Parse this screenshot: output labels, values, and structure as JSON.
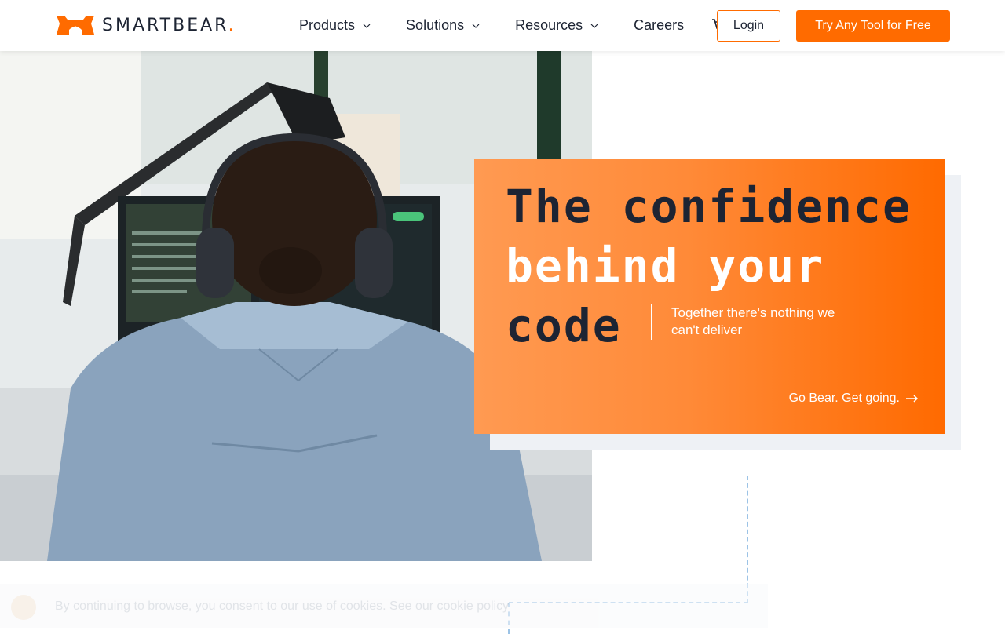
{
  "header": {
    "brand": "SMARTBEAR",
    "brand_suffix": ".",
    "nav": [
      {
        "label": "Products",
        "has_dropdown": true
      },
      {
        "label": "Solutions",
        "has_dropdown": true
      },
      {
        "label": "Resources",
        "has_dropdown": true
      },
      {
        "label": "Careers",
        "has_dropdown": false
      }
    ],
    "cart_icon": "shopping-cart-icon",
    "login_label": "Login",
    "try_label": "Try Any Tool for Free"
  },
  "hero": {
    "headline_line1": "The confidence",
    "headline_line2": "behind your",
    "headline_line3": "code",
    "tagline": "Together there's nothing we can't deliver",
    "cta_label": "Go Bear. Get going.",
    "cta_icon": "arrow-right-icon"
  },
  "cookie_banner": {
    "text": "By continuing to browse, you consent to our use of cookies. See our cookie policy"
  },
  "colors": {
    "brand_orange": "#ff6b00",
    "text_dark": "#1d2433",
    "card_shadow": "#eef1f5",
    "dashed_line": "#9cc3e6"
  }
}
